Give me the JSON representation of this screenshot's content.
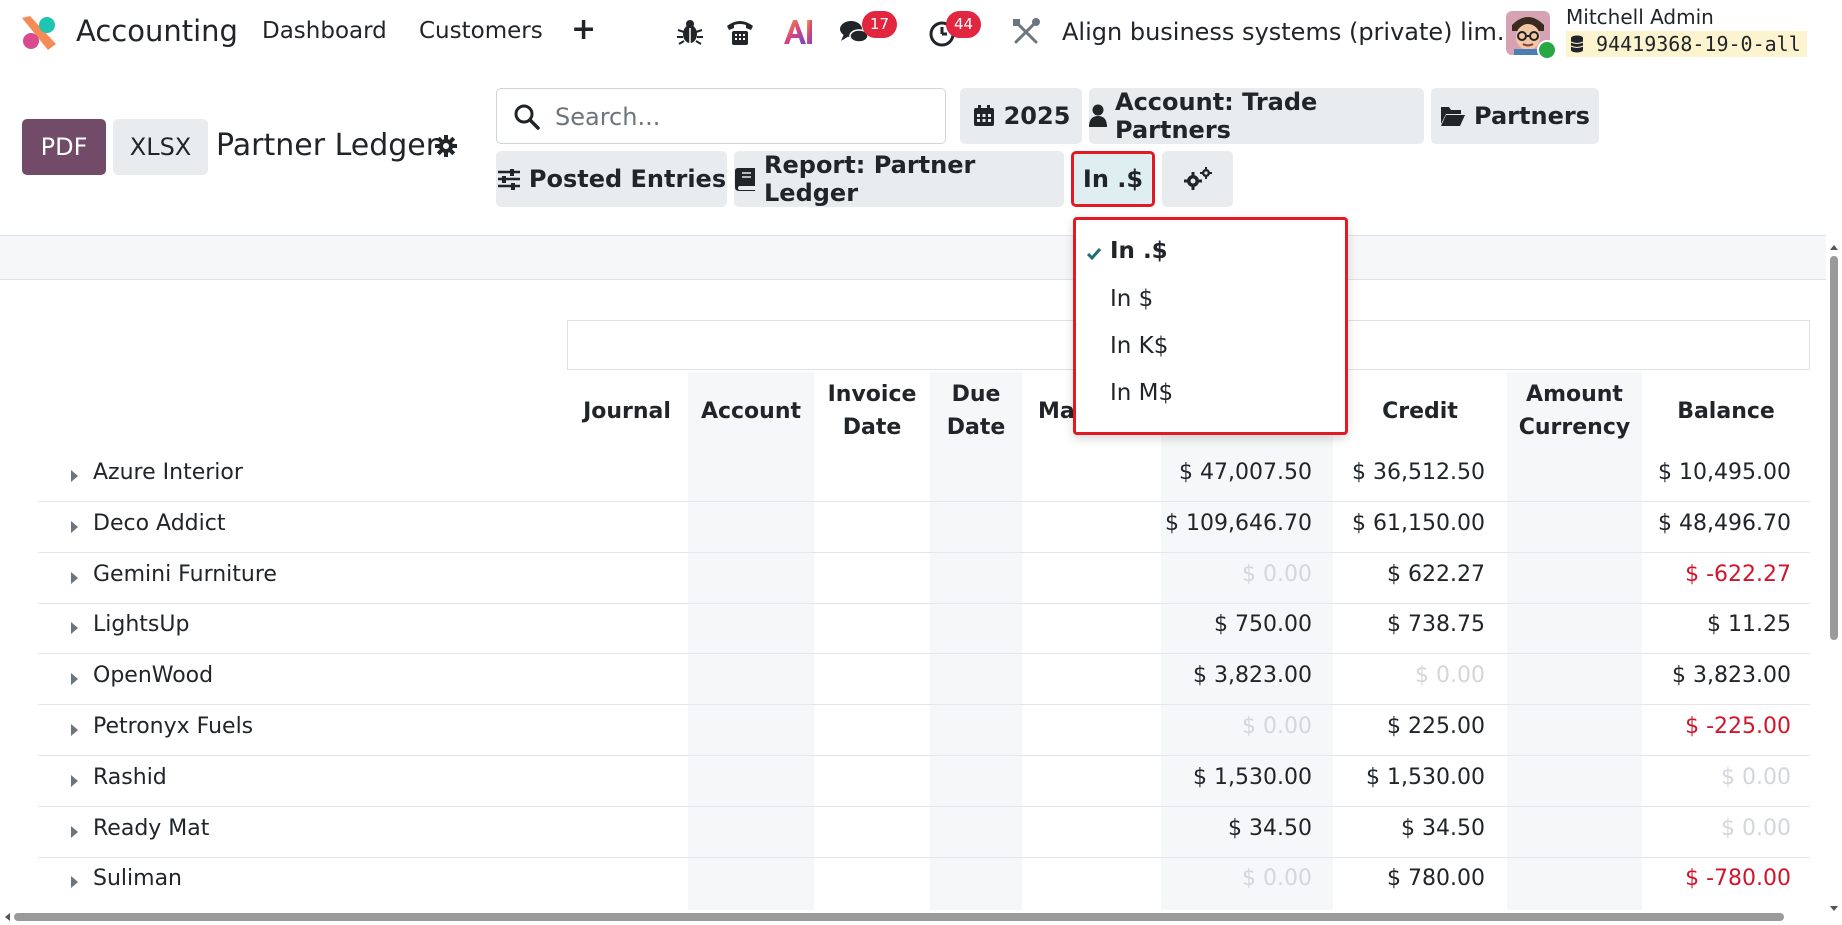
{
  "navbar": {
    "app_name": "Accounting",
    "menu": [
      "Dashboard",
      "Customers"
    ],
    "plus_label": "+",
    "chat_badge": "17",
    "activity_badge": "44",
    "company": "Align business systems (private) lim...",
    "user_name": "Mitchell Admin",
    "db_name": "94419368-19-0-all"
  },
  "control_panel": {
    "pdf_label": "PDF",
    "xlsx_label": "XLSX",
    "title": "Partner Ledger",
    "search_placeholder": "Search...",
    "filters": {
      "date": "2025",
      "account": "Account: Trade Partners",
      "partners": "Partners",
      "posted": "Posted Entries",
      "report": "Report: Partner Ledger",
      "unit": "In .$"
    }
  },
  "unit_dropdown": {
    "items": [
      "In .$",
      "In $",
      "In K$",
      "In M$"
    ],
    "selected": "In .$"
  },
  "table": {
    "headers": {
      "journal": "Journal",
      "account": "Account",
      "invoice_date_1": "Invoice",
      "invoice_date_2": "Date",
      "due_date_1": "Due",
      "due_date_2": "Date",
      "matching": "Ma",
      "credit": "Credit",
      "amount_currency_1": "Amount",
      "amount_currency_2": "Currency",
      "balance": "Balance"
    },
    "rows": [
      {
        "name": "Azure Interior",
        "debit": "$ 47,007.50",
        "credit": "$ 36,512.50",
        "balance": "$ 10,495.00"
      },
      {
        "name": "Deco Addict",
        "debit": "$ 109,646.70",
        "credit": "$ 61,150.00",
        "balance": "$ 48,496.70"
      },
      {
        "name": "Gemini Furniture",
        "debit": "$ 0.00",
        "credit": "$ 622.27",
        "balance": "$ -622.27"
      },
      {
        "name": "LightsUp",
        "debit": "$ 750.00",
        "credit": "$ 738.75",
        "balance": "$ 11.25"
      },
      {
        "name": "OpenWood",
        "debit": "$ 3,823.00",
        "credit": "$ 0.00",
        "balance": "$ 3,823.00"
      },
      {
        "name": "Petronyx Fuels",
        "debit": "$ 0.00",
        "credit": "$ 225.00",
        "balance": "$ -225.00"
      },
      {
        "name": "Rashid",
        "debit": "$ 1,530.00",
        "credit": "$ 1,530.00",
        "balance": "$ 0.00"
      },
      {
        "name": "Ready Mat",
        "debit": "$ 34.50",
        "credit": "$ 34.50",
        "balance": "$ 0.00"
      },
      {
        "name": "Suliman",
        "debit": "$ 0.00",
        "credit": "$ 780.00",
        "balance": "$ -780.00"
      }
    ]
  },
  "colors": {
    "brand": "#714b67",
    "highlight": "#e01b24",
    "negative": "#d1162b",
    "zero": "#d3d6da",
    "badge": "#e2263f"
  }
}
